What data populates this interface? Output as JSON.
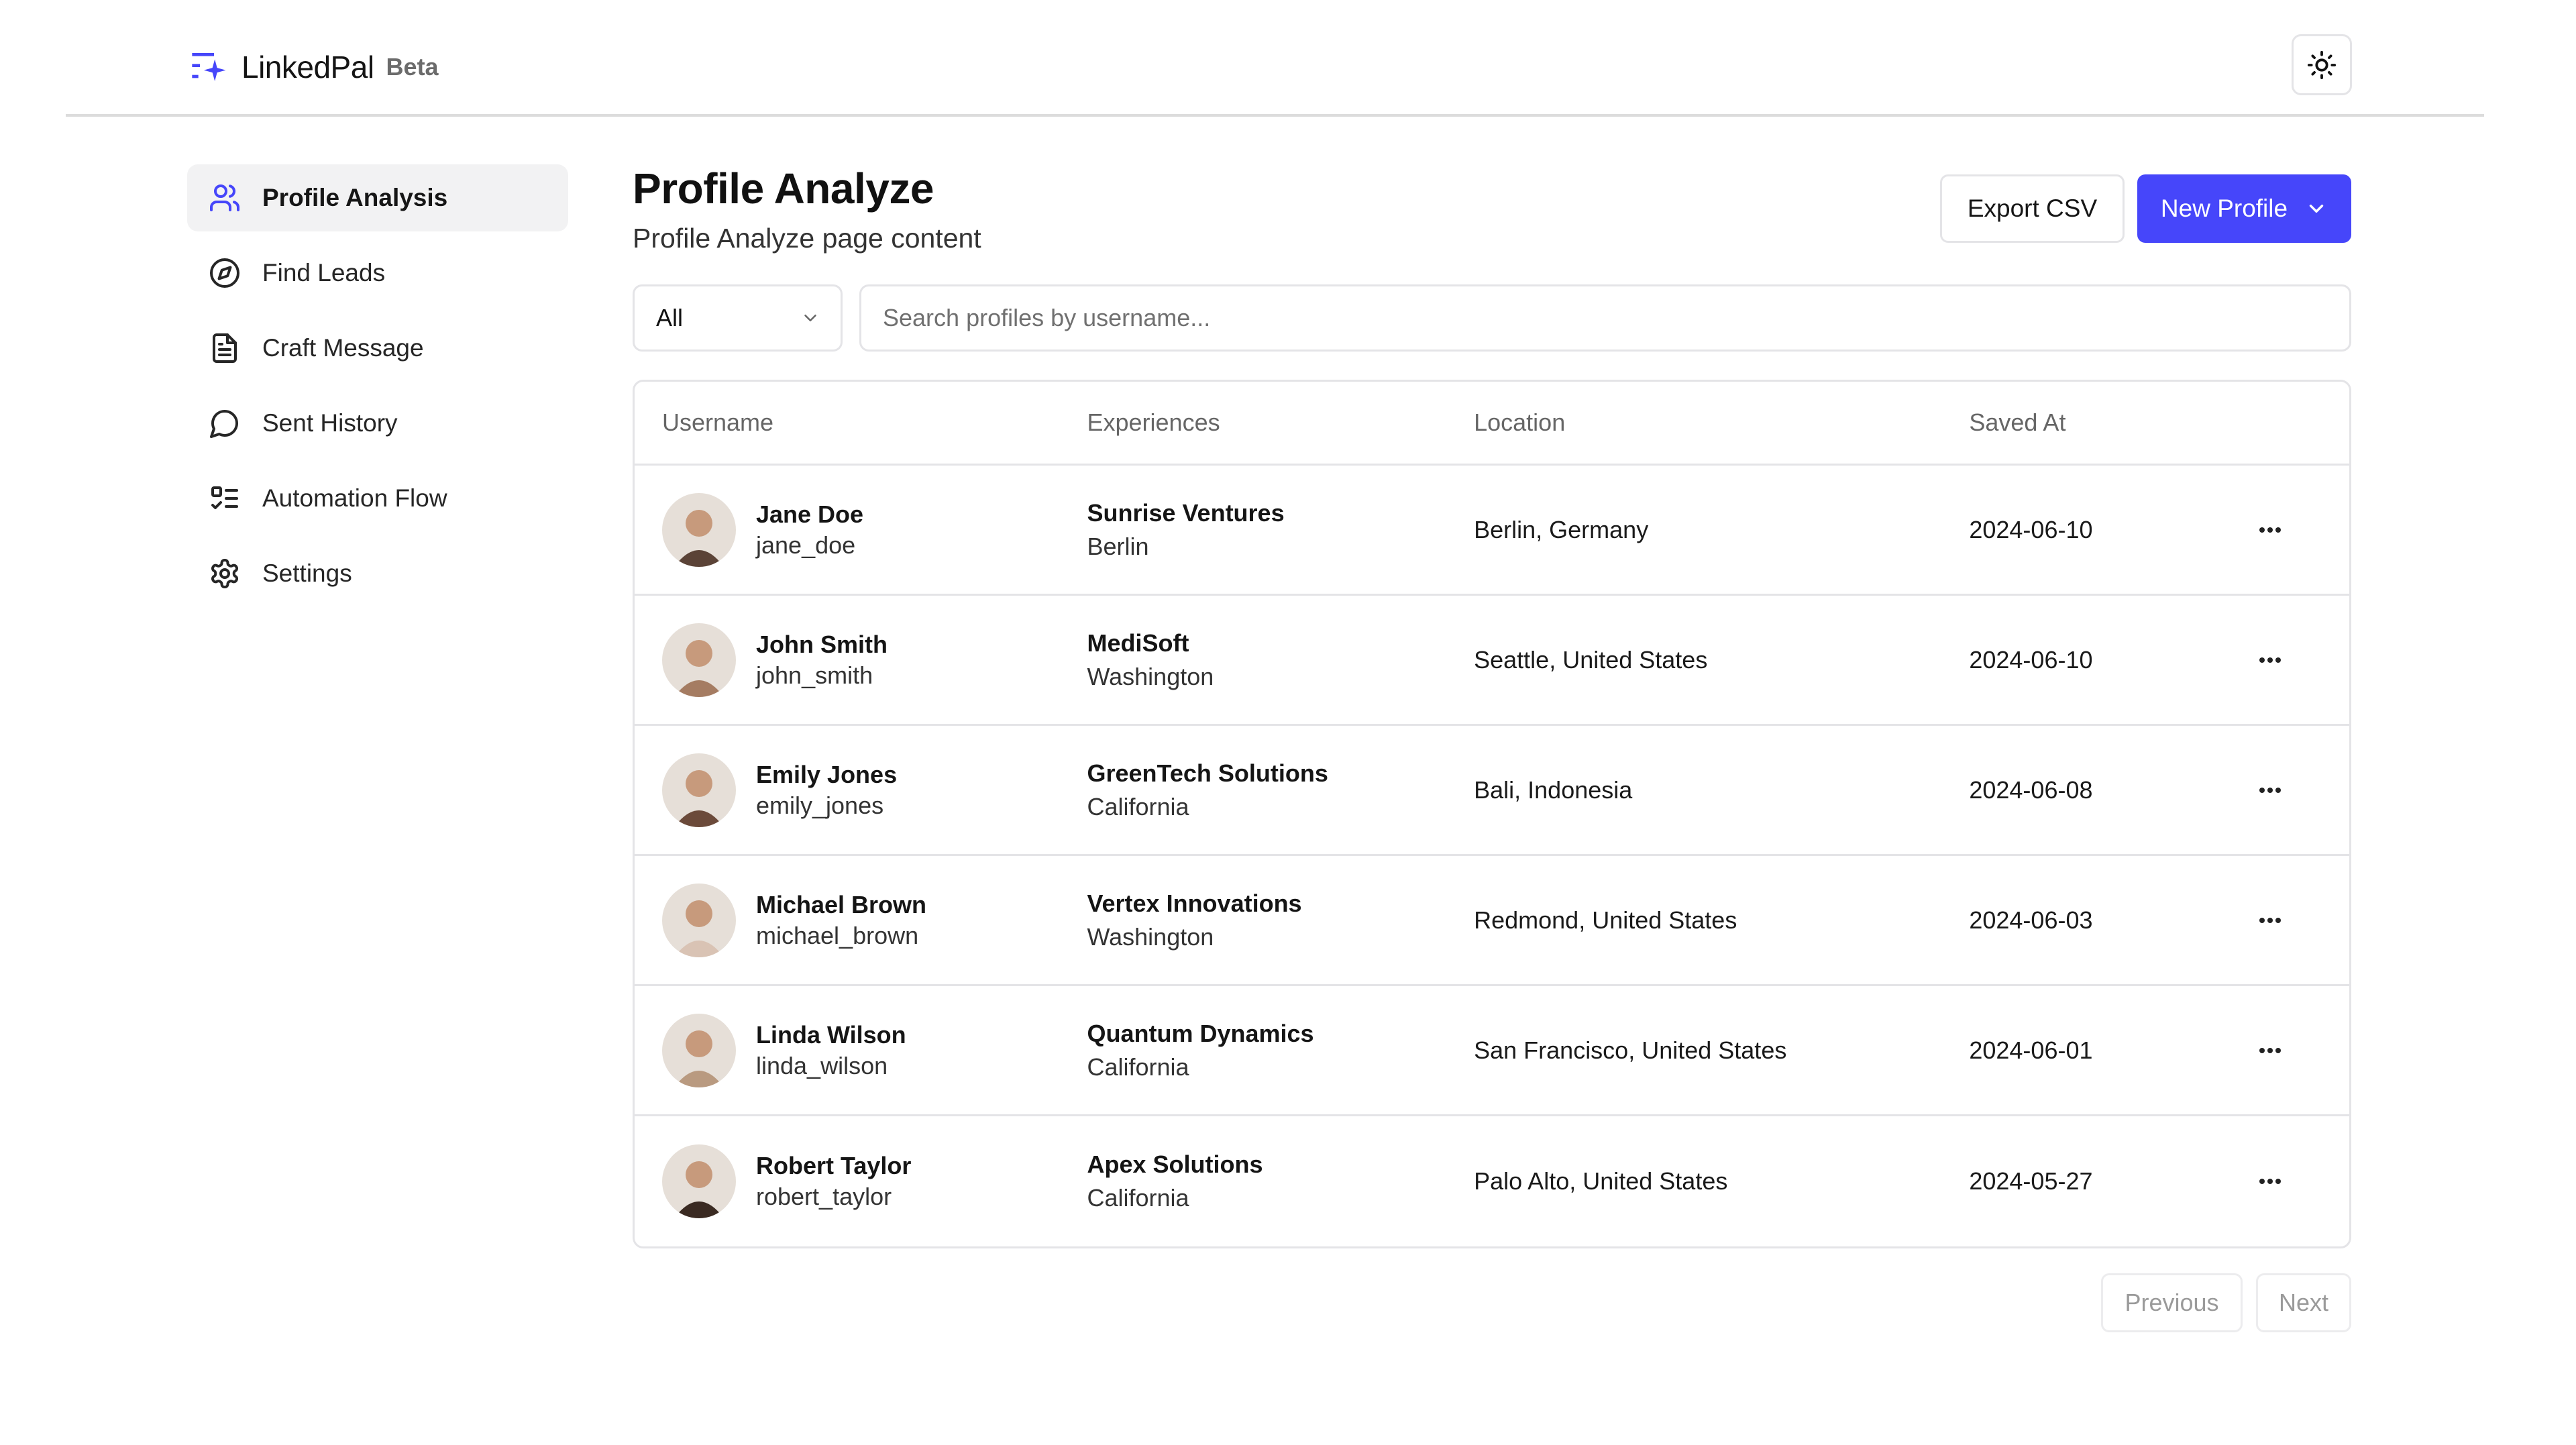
{
  "app": {
    "name": "LinkedPal",
    "badge": "Beta",
    "brand_color": "#4646fa",
    "theme_toggle_icon": "sun-icon"
  },
  "sidebar": {
    "items": [
      {
        "label": "Profile Analysis",
        "icon": "users-icon",
        "active": true
      },
      {
        "label": "Find Leads",
        "icon": "compass-icon",
        "active": false
      },
      {
        "label": "Craft Message",
        "icon": "file-text-icon",
        "active": false
      },
      {
        "label": "Sent History",
        "icon": "message-circle-icon",
        "active": false
      },
      {
        "label": "Automation Flow",
        "icon": "list-checks-icon",
        "active": false
      },
      {
        "label": "Settings",
        "icon": "gear-icon",
        "active": false
      }
    ]
  },
  "page": {
    "title": "Profile Analyze",
    "subtitle": "Profile Analyze page content",
    "export_label": "Export CSV",
    "new_profile_label": "New Profile"
  },
  "filters": {
    "select_value": "All",
    "search_placeholder": "Search profiles by username...",
    "search_value": ""
  },
  "table": {
    "columns": [
      "Username",
      "Experiences",
      "Location",
      "Saved At",
      ""
    ],
    "rows": [
      {
        "name": "Jane Doe",
        "username": "jane_doe",
        "company": "Sunrise Ventures",
        "region": "Berlin",
        "location": "Berlin, Germany",
        "saved_at": "2024-06-10",
        "avatar_color": "#5b4337"
      },
      {
        "name": "John Smith",
        "username": "john_smith",
        "company": "MediSoft",
        "region": "Washington",
        "location": "Seattle, United States",
        "saved_at": "2024-06-10",
        "avatar_color": "#a57c62"
      },
      {
        "name": "Emily Jones",
        "username": "emily_jones",
        "company": "GreenTech Solutions",
        "region": "California",
        "location": "Bali, Indonesia",
        "saved_at": "2024-06-08",
        "avatar_color": "#6b4a3a"
      },
      {
        "name": "Michael Brown",
        "username": "michael_brown",
        "company": "Vertex Innovations",
        "region": "Washington",
        "location": "Redmond, United States",
        "saved_at": "2024-06-03",
        "avatar_color": "#d9c3b4"
      },
      {
        "name": "Linda Wilson",
        "username": "linda_wilson",
        "company": "Quantum Dynamics",
        "region": "California",
        "location": "San Francisco, United States",
        "saved_at": "2024-06-01",
        "avatar_color": "#b99a80"
      },
      {
        "name": "Robert Taylor",
        "username": "robert_taylor",
        "company": "Apex Solutions",
        "region": "California",
        "location": "Palo Alto, United States",
        "saved_at": "2024-05-27",
        "avatar_color": "#3a2a22"
      }
    ]
  },
  "pagination": {
    "previous_label": "Previous",
    "next_label": "Next"
  }
}
